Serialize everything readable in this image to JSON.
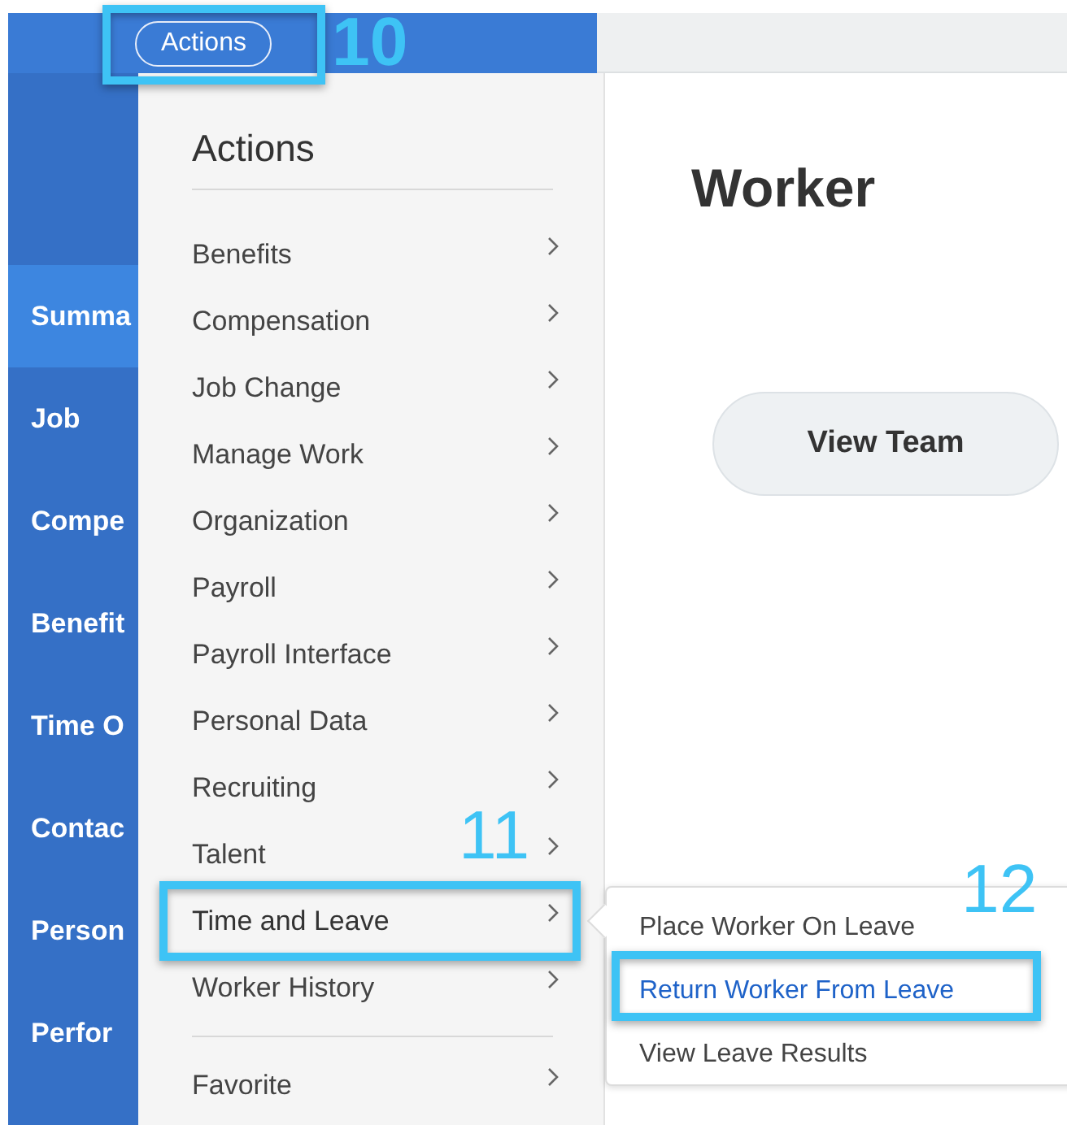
{
  "top_bar": {
    "actions_button": "Actions"
  },
  "sidebar": {
    "items": [
      {
        "label": "Summa",
        "selected": true
      },
      {
        "label": "Job",
        "selected": false
      },
      {
        "label": "Compe",
        "selected": false
      },
      {
        "label": "Benefit",
        "selected": false
      },
      {
        "label": "Time O",
        "selected": false
      },
      {
        "label": "Contac",
        "selected": false
      },
      {
        "label": "Person",
        "selected": false
      },
      {
        "label": "Perfor",
        "selected": false
      }
    ]
  },
  "actions_menu": {
    "title": "Actions",
    "items": [
      {
        "label": "Benefits",
        "selected": false
      },
      {
        "label": "Compensation",
        "selected": false
      },
      {
        "label": "Job Change",
        "selected": false
      },
      {
        "label": "Manage Work",
        "selected": false
      },
      {
        "label": "Organization",
        "selected": false
      },
      {
        "label": "Payroll",
        "selected": false
      },
      {
        "label": "Payroll Interface",
        "selected": false
      },
      {
        "label": "Personal Data",
        "selected": false
      },
      {
        "label": "Recruiting",
        "selected": false
      },
      {
        "label": "Talent",
        "selected": false
      },
      {
        "label": "Time and Leave",
        "selected": true
      },
      {
        "label": "Worker History",
        "selected": false
      }
    ],
    "footer_items": [
      {
        "label": "Favorite",
        "selected": false
      }
    ]
  },
  "submenu": {
    "items": [
      {
        "label": "Place Worker On Leave",
        "selected": false
      },
      {
        "label": "Return Worker From Leave",
        "selected": true
      },
      {
        "label": "View Leave Results",
        "selected": false
      }
    ]
  },
  "worker": {
    "title": "Worker",
    "view_team_button": "View Team"
  },
  "annotations": [
    {
      "number": "10"
    },
    {
      "number": "11"
    },
    {
      "number": "12"
    }
  ]
}
